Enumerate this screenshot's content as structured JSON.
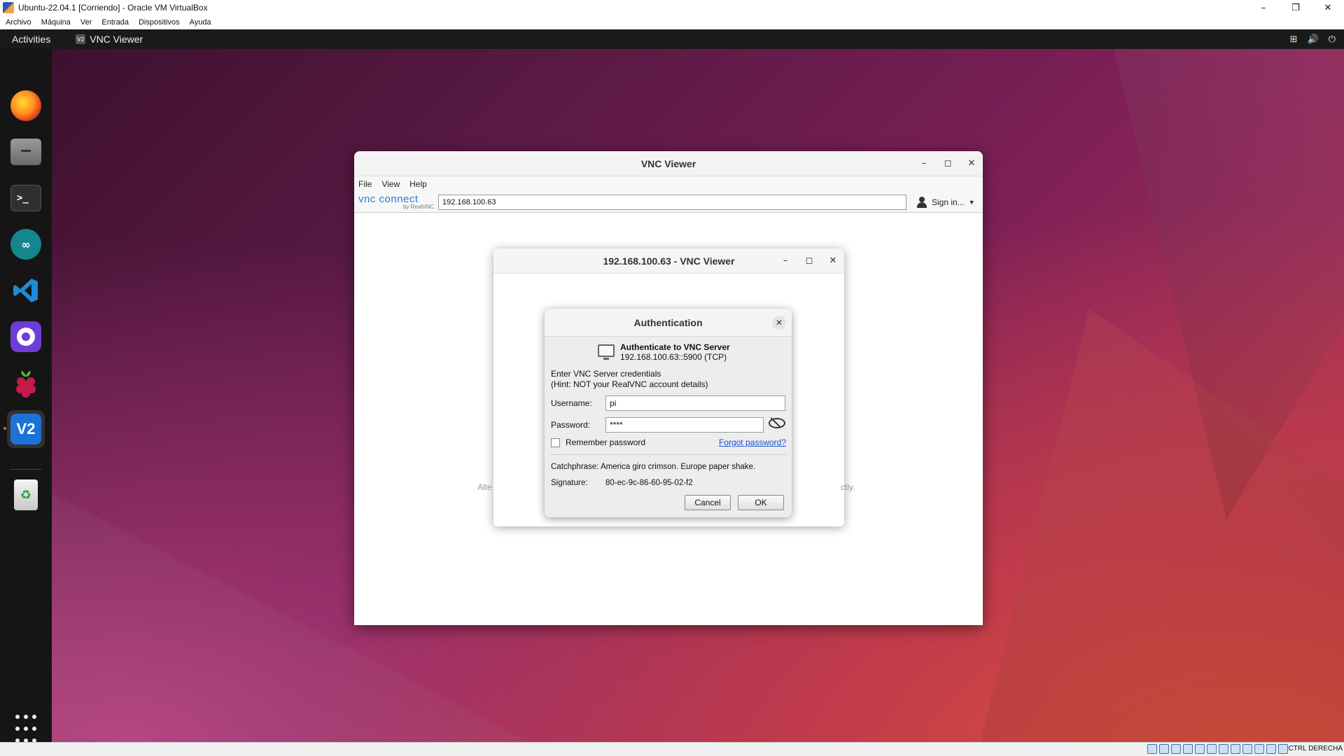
{
  "host": {
    "title": "Ubuntu-22.04.1 [Corriendo] - Oracle VM VirtualBox",
    "menu": [
      "Archivo",
      "Máquina",
      "Ver",
      "Entrada",
      "Dispositivos",
      "Ayuda"
    ],
    "window_controls": {
      "minimize": "–",
      "restore": "❐",
      "close": "✕"
    },
    "host_key": "CTRL DERECHA"
  },
  "ubuntu": {
    "activities": "Activities",
    "app_menu": {
      "icon_text": "V2",
      "label": "VNC Viewer"
    },
    "tray": {
      "network": "⊞",
      "volume": "🔊",
      "power": "⏻"
    },
    "dock": [
      {
        "name": "firefox"
      },
      {
        "name": "files"
      },
      {
        "name": "terminal",
        "glyph": ">_"
      },
      {
        "name": "arduino",
        "glyph": "∞"
      },
      {
        "name": "vscode"
      },
      {
        "name": "github"
      },
      {
        "name": "raspberry-pi-imager"
      },
      {
        "name": "vnc-viewer",
        "glyph": "V2",
        "active": true
      },
      {
        "name": "trash",
        "glyph": "♻"
      }
    ]
  },
  "vnc_main": {
    "title": "VNC Viewer",
    "menu": [
      "File",
      "View",
      "Help"
    ],
    "logo_line1": "vnc connect",
    "logo_line2": "by RealVNC",
    "address_value": "192.168.100.63",
    "signin_label": "Sign in..."
  },
  "conn_window": {
    "title": "192.168.100.63 - VNC Viewer",
    "behind_text_left": "Alte",
    "behind_text_right": "ctly."
  },
  "auth": {
    "title": "Authentication",
    "server_title": "Authenticate to VNC Server",
    "server_addr": "192.168.100.63::5900 (TCP)",
    "cred_line1": "Enter VNC Server credentials",
    "cred_line2": "(Hint: NOT your RealVNC account details)",
    "username_label": "Username:",
    "username_value": "pi",
    "password_label": "Password:",
    "password_value": "****",
    "remember_label": "Remember password",
    "remember_checked": false,
    "forgot_label": "Forgot password?",
    "catchphrase": "Catchphrase: America giro crimson. Europe paper shake.",
    "signature_label": "Signature:",
    "signature_value": "80-ec-9c-86-60-95-02-f2",
    "cancel_label": "Cancel",
    "ok_label": "OK"
  }
}
